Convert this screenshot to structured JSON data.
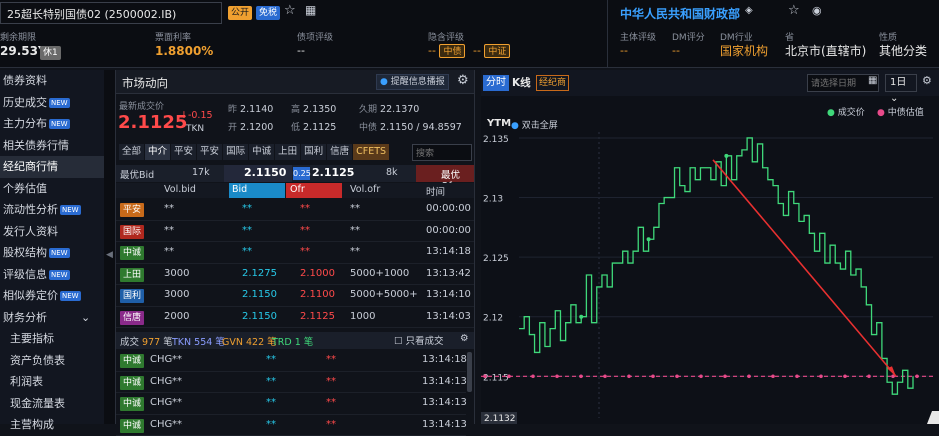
{
  "header": {
    "bond_title": "25超长特别国债02 (2500002.IB)",
    "tag1": "公开",
    "tag2": "免税",
    "remaining_label": "剩余期限",
    "remaining_value": "29.53Y",
    "remaining_tag": "休1",
    "coupon_label": "票面利率",
    "coupon_value": "1.8800%",
    "rating_label": "债项评级",
    "rating_value": "--",
    "valuation_label": "隐含评级",
    "valuation_value1": "--",
    "valuation_tag1": "中债",
    "valuation_value2": "--",
    "valuation_tag2": "中证",
    "issuer": "中华人民共和国财政部",
    "issuer_rating_label": "主体评级",
    "issuer_rating_value": "--",
    "dm_rating_label": "DM评分",
    "dm_rating_value": "--",
    "dm_industry_label": "DM行业",
    "dm_industry_value": "国家机构",
    "province_label": "省",
    "province_value": "北京市(直辖市)",
    "nature_label": "性质",
    "nature_value": "其他分类"
  },
  "sidebar": {
    "items": [
      {
        "label": "债券资料",
        "new": false,
        "active": false,
        "sub": false
      },
      {
        "label": "历史成交",
        "new": true,
        "active": false,
        "sub": false
      },
      {
        "label": "主力分布",
        "new": true,
        "active": false,
        "sub": false
      },
      {
        "label": "相关债券行情",
        "new": false,
        "active": false,
        "sub": false
      },
      {
        "label": "经纪商行情",
        "new": false,
        "active": true,
        "sub": false
      },
      {
        "label": "个券估值",
        "new": false,
        "active": false,
        "sub": false
      },
      {
        "label": "流动性分析",
        "new": true,
        "active": false,
        "sub": false
      },
      {
        "label": "发行人资料",
        "new": false,
        "active": false,
        "sub": false
      },
      {
        "label": "股权结构",
        "new": true,
        "active": false,
        "sub": false
      },
      {
        "label": "评级信息",
        "new": true,
        "active": false,
        "sub": false
      },
      {
        "label": "相似券定价",
        "new": true,
        "active": false,
        "sub": false
      },
      {
        "label": "财务分析",
        "new": false,
        "active": false,
        "sub": false,
        "caret": "⌄"
      },
      {
        "label": "主要指标",
        "new": false,
        "active": false,
        "sub": true
      },
      {
        "label": "资产负债表",
        "new": false,
        "active": false,
        "sub": true
      },
      {
        "label": "利润表",
        "new": false,
        "active": false,
        "sub": true
      },
      {
        "label": "现金流量表",
        "new": false,
        "active": false,
        "sub": true
      },
      {
        "label": "主营构成",
        "new": false,
        "active": false,
        "sub": true
      }
    ]
  },
  "market": {
    "title": "市场动向",
    "alert_btn": "提醒信息播报",
    "latest_label": "最新成交价",
    "latest_value": "2.1125",
    "change": "↓-0.15",
    "tkn": "TKN",
    "prev_label": "昨",
    "prev_value": "2.1140",
    "open_label": "开",
    "open_value": "2.1200",
    "high_label": "高",
    "high_value": "2.1350",
    "low_label": "低",
    "low_value": "2.1125",
    "vol_label": "久期",
    "vol_value": "22.1370",
    "mid_label": "中债",
    "mid_value": "2.1150 / 94.8597",
    "brokers": [
      "全部",
      "中介",
      "平安",
      "平安",
      "国际",
      "中诚",
      "上田",
      "国利",
      "信唐",
      "CFETS"
    ],
    "broker_search_placeholder": "搜索",
    "best_bid_label": "最优Bid",
    "best_bid_vol": "17k",
    "best_bid": "2.1150",
    "spread": "0.25",
    "best_ofr": "2.1125",
    "best_ofr_vol": "8k",
    "best_ofr_label": "最优Ofr",
    "cols": [
      "",
      "Vol.bid",
      "Bid",
      "Ofr",
      "Vol.ofr",
      "时间"
    ],
    "rows": [
      {
        "broker": "平安",
        "color": "c-or",
        "volbid": "**",
        "bid": "**",
        "ofr": "**",
        "volofr": "**",
        "time": "00:00:00"
      },
      {
        "broker": "国际",
        "color": "c-rd",
        "volbid": "**",
        "bid": "**",
        "ofr": "**",
        "volofr": "**",
        "time": "00:00:00"
      },
      {
        "broker": "中诚",
        "color": "c-gr",
        "volbid": "**",
        "bid": "**",
        "ofr": "**",
        "volofr": "**",
        "time": "13:14:18"
      },
      {
        "broker": "上田",
        "color": "c-gr",
        "volbid": "3000",
        "bid": "2.1275",
        "ofr": "2.1000",
        "volofr": "5000+1000",
        "time": "13:13:42"
      },
      {
        "broker": "国利",
        "color": "c-bl",
        "volbid": "3000",
        "bid": "2.1150",
        "ofr": "2.1100",
        "volofr": "5000+5000+",
        "time": "13:14:10"
      },
      {
        "broker": "信唐",
        "color": "c-pu",
        "volbid": "2000",
        "bid": "2.1150",
        "ofr": "2.1125",
        "volofr": "1000",
        "time": "13:14:03"
      }
    ],
    "trade_summary": {
      "label": "成交",
      "count": "977",
      "unit": "笔",
      "tkn": "TKN 554 笔",
      "gvn": "GVN 422 笔",
      "trd": "TRD 1 笔",
      "only_label": "只看成交"
    },
    "trades": [
      {
        "broker": "中诚",
        "type": "CHG",
        "v": "**",
        "b": "**",
        "o": "**",
        "time": "13:14:18"
      },
      {
        "broker": "中诚",
        "type": "CHG",
        "v": "**",
        "b": "**",
        "o": "**",
        "time": "13:14:13"
      },
      {
        "broker": "中诚",
        "type": "CHG",
        "v": "**",
        "b": "**",
        "o": "**",
        "time": "13:14:13"
      },
      {
        "broker": "中诚",
        "type": "CHG",
        "v": "**",
        "b": "**",
        "o": "**",
        "time": "13:14:13"
      }
    ]
  },
  "chart_panel": {
    "tab_fenshi": "分时",
    "tab_kline": "K线",
    "tab_jingji": "经纪商",
    "date_placeholder": "请选择日期",
    "period": "1日",
    "ytm_label": "YTM",
    "ytm_hint": "双击全屏",
    "legend_trade": "成交价",
    "legend_mid": "中债估值",
    "last_price_tag": "2.1132"
  },
  "chart_data": {
    "type": "line",
    "ylim": [
      2.1115,
      2.1355
    ],
    "yticks": [
      2.115,
      2.12,
      2.125,
      2.13,
      2.135
    ],
    "series": [
      {
        "name": "成交价",
        "color": "#3fd87a",
        "values": [
          2.119,
          2.12,
          2.1185,
          2.117,
          2.1195,
          2.1175,
          2.119,
          2.1205,
          2.118,
          2.1195,
          2.121,
          2.1195,
          2.12,
          2.1235,
          2.1195,
          2.1225,
          2.1235,
          2.1225,
          2.1245,
          2.1245,
          2.1255,
          2.1245,
          2.1255,
          2.1275,
          2.1255,
          2.1265,
          2.1275,
          2.1295,
          2.13,
          2.13,
          2.1325,
          2.131,
          2.1305,
          2.1325,
          2.1315,
          2.1325,
          2.1325,
          2.1315,
          2.133,
          2.131,
          2.1335,
          2.1315,
          2.1335,
          2.134,
          2.135,
          2.133,
          2.1345,
          2.1325,
          2.1315,
          2.131,
          2.1295,
          2.1285,
          2.1305,
          2.1295,
          2.128,
          2.1285,
          2.127,
          2.1255,
          2.127,
          2.1245,
          2.126,
          2.1245,
          2.124,
          2.1255,
          2.1235,
          2.124,
          2.1225,
          2.121,
          2.1185,
          2.1195,
          2.1165,
          2.1145,
          2.1135,
          2.1145,
          2.1155,
          2.114,
          2.115
        ]
      },
      {
        "name": "中债估值",
        "color": "#e84a8a",
        "values": [
          2.115
        ]
      }
    ]
  }
}
